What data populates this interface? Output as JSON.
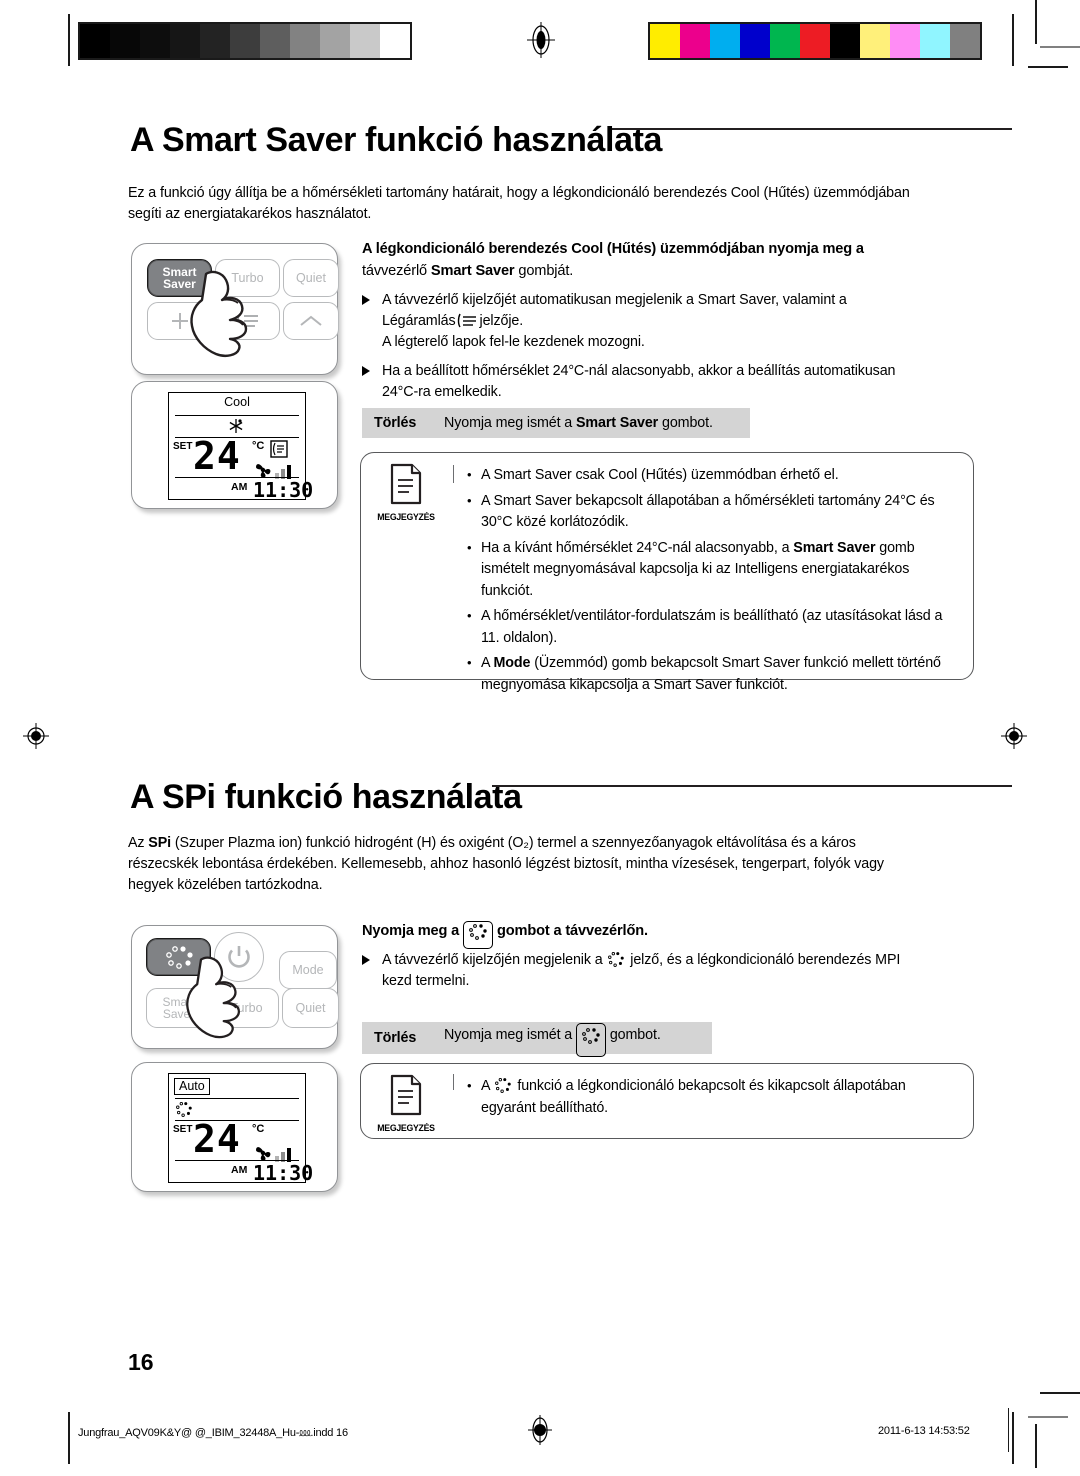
{
  "page": {
    "number": "16",
    "footer_file": "Jungfrau_AQV09K&Y@ @_IBIM_32448A_Hu-⅏.indd   16",
    "footer_timestamp": "2011-6-13   14:53:52"
  },
  "section1": {
    "title": "A Smart Saver funkció használata",
    "intro": "Ez a funkció úgy állítja be a hőmérsékleti tartomány határait, hogy a légkondicionáló berendezés Cool (Hűtés) üzemmódjában segíti az energiatakarékos használatot.",
    "step_head_line1": "A légkondicionáló berendezés Cool (Hűtés) üzemmódjában nyomja meg a",
    "step_head_line2_pre": "távvezérlő ",
    "step_head_line2_strong": "Smart Saver",
    "step_head_line2_post": " gombját.",
    "bullets": [
      {
        "line1": "A távvezérlő kijelzőjét automatikusan megjelenik a Smart Saver, valamint a",
        "line2_pre": "Légáramlás",
        "line2_icon": "airflow-icon",
        "line2_post": "jelzője.",
        "line3": "A légterelő lapok fel-le kezdenek mozogni."
      },
      {
        "line1": "Ha a beállított hőmérséklet 24°C-nál alacsonyabb, akkor a beállítás automatikusan",
        "line2": "24°C-ra emelkedik."
      }
    ],
    "clear": {
      "label": "Törlés",
      "text_pre": "Nyomja meg ismét a ",
      "text_strong": "Smart Saver",
      "text_post": " gombot."
    },
    "note": {
      "caption": "MEGJEGYZÉS",
      "items": [
        {
          "text": "A Smart Saver csak Cool (Hűtés) üzemmódban érhető el."
        },
        {
          "text": "A Smart Saver bekapcsolt állapotában a hőmérsékleti tartomány 24°C és 30°C közé korlátozódik."
        },
        {
          "pre": "Ha a kívánt hőmérséklet 24°C-nál alacsonyabb, a ",
          "strong": "Smart Saver",
          "post": " gomb ismételt megnyomásával kapcsolja ki az Intelligens energiatakarékos funkciót."
        },
        {
          "text": "A hőmérséklet/ventilátor-fordulatszám is beállítható (az utasításokat lásd a 11. oldalon)."
        },
        {
          "pre": "A ",
          "strong": "Mode",
          "post": " (Üzemmód) gomb bekapcsolt Smart Saver funkció mellett történő megnyomása kikapcsolja a Smart Saver funkciót."
        }
      ]
    },
    "remote": {
      "buttons": [
        {
          "label": "Smart\nSaver",
          "name": "smart-saver-button",
          "highlighted": true
        },
        {
          "label": "Turbo",
          "name": "turbo-button",
          "highlighted": false
        },
        {
          "label": "Quiet",
          "name": "quiet-button",
          "highlighted": false
        },
        {
          "label": "+",
          "name": "plus-button",
          "highlighted": false
        },
        {
          "label": "",
          "name": "airflow-button",
          "highlighted": false
        },
        {
          "label": "",
          "name": "up-button",
          "highlighted": false
        }
      ]
    },
    "lcd": {
      "mode": "Cool",
      "set_label": "SET",
      "temperature": "24",
      "unit": "°C",
      "ampm": "AM",
      "time": "11:30"
    }
  },
  "section2": {
    "title_pre": "A ",
    "title_strong": "SPi",
    "title_post": " funkció használata",
    "title_plain": "A SPi funkció használata",
    "intro_pre": "Az ",
    "intro_strong": "SPi",
    "intro_post": " (Szuper Plazma ion) funkció hidrogént (H) és oxigént (O₂) termel a szennyezőanyagok eltávolítása és a káros részecskék lebontása érdekében. Kellemesebb, ahhoz hasonló légzést biztosít, mintha vízesések, tengerpart, folyók vagy hegyek közelében tartózkodna.",
    "step_head_pre": "Nyomja meg a ",
    "step_head_icon": "spi-icon",
    "step_head_post": " gombot a távvezérlőn.",
    "bullet": {
      "line1_pre": "A távvezérlő kijelzőjén megjelenik a ",
      "line1_icon": "spi-icon",
      "line1_post": " jelző, és a légkondicionáló berendezés MPI",
      "line2": "kezd termelni."
    },
    "clear": {
      "label": "Törlés",
      "text_pre": "Nyomja meg ismét a ",
      "text_icon": "spi-icon",
      "text_post": " gombot."
    },
    "note": {
      "caption": "MEGJEGYZÉS",
      "item_pre": "A ",
      "item_icon": "spi-icon",
      "item_post": " funkció a légkondicionáló bekapcsolt és kikapcsolt állapotában egyaránt beállítható."
    },
    "remote": {
      "buttons": [
        {
          "label": "",
          "name": "spi-button",
          "highlighted": true
        },
        {
          "label": "",
          "name": "power-button",
          "highlighted": false
        },
        {
          "label": "Mode",
          "name": "mode-button",
          "highlighted": false
        },
        {
          "label": "Smart\nSaver",
          "name": "smart-saver-button",
          "highlighted": false
        },
        {
          "label": "Turbo",
          "name": "turbo-button",
          "highlighted": false
        },
        {
          "label": "Quiet",
          "name": "quiet-button",
          "highlighted": false
        }
      ]
    },
    "lcd": {
      "mode": "Auto",
      "set_label": "SET",
      "temperature": "24",
      "unit": "°C",
      "ampm": "AM",
      "time": "11:30"
    }
  },
  "calibration": {
    "grayscale": [
      "#000000",
      "#070707",
      "#0d0d0d",
      "#161616",
      "#232323",
      "#3d3d3d",
      "#5e5e5e",
      "#828282",
      "#a3a3a3",
      "#c9c9c9",
      "#ffffff"
    ],
    "colors": [
      "#ffed00",
      "#ec008c",
      "#00aeef",
      "#0000cc",
      "#00b64f",
      "#ed1c24",
      "#000000",
      "#fff07a",
      "#ff8cf5",
      "#90f5ff",
      "#808080"
    ]
  }
}
